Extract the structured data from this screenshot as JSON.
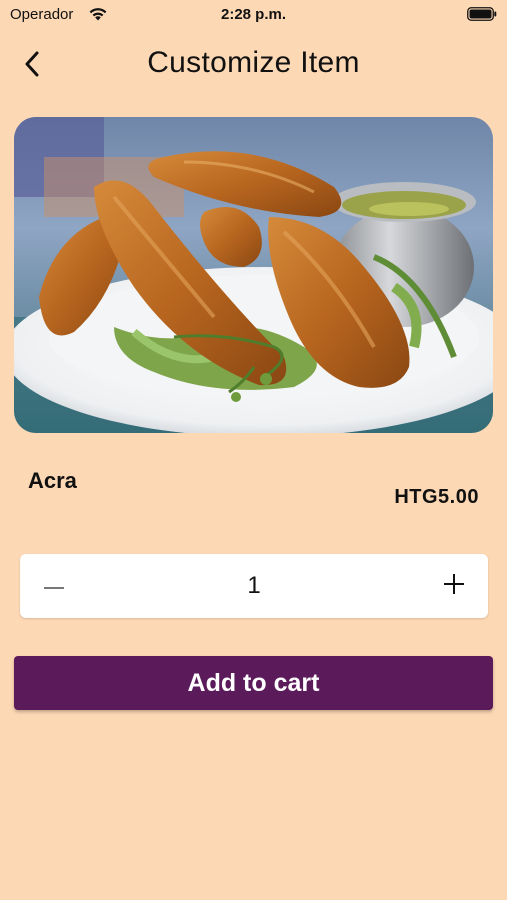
{
  "status_bar": {
    "carrier": "Operador",
    "time": "2:28 p.m.",
    "icons": [
      "wifi-icon",
      "battery-icon"
    ]
  },
  "nav": {
    "back_icon": "chevron-left-icon",
    "title": "Customize Item"
  },
  "item": {
    "image_subject": "fried acra fritters on a plate with a dipping sauce cup",
    "name": "Acra",
    "price": "HTG5.00"
  },
  "quantity": {
    "minus_label": "−",
    "value": "1",
    "plus_label": "+"
  },
  "actions": {
    "add_to_cart_label": "Add to cart"
  },
  "colors": {
    "background": "#FDD8B5",
    "accent": "#5B1B5A",
    "card": "#FFFFFF"
  }
}
